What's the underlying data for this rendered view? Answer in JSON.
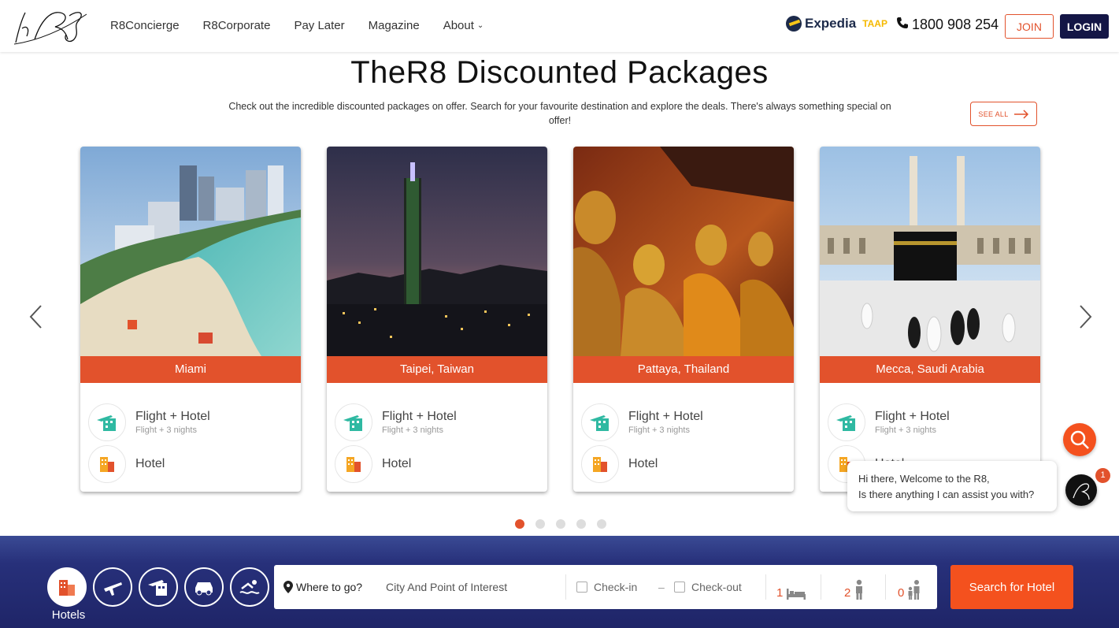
{
  "header": {
    "nav": [
      {
        "label": "R8Concierge"
      },
      {
        "label": "R8Corporate"
      },
      {
        "label": "Pay Later"
      },
      {
        "label": "Magazine"
      },
      {
        "label": "About"
      }
    ],
    "expedia": {
      "brand": "Expedia",
      "taap": "TAAP"
    },
    "phone": "1800 908 254",
    "join_label": "JOIN",
    "login_label": "LOGIN"
  },
  "section": {
    "title": "TheR8 Discounted Packages",
    "subtitle": "Check out the incredible discounted packages on offer. Search for your favourite destination and explore the deals. There's always something special on offer!",
    "see_all_label": "SEE ALL"
  },
  "cards": [
    {
      "destination": "Miami",
      "package_label": "Flight + Hotel",
      "package_sub": "Flight + 3 nights",
      "hotel_label": "Hotel"
    },
    {
      "destination": "Taipei, Taiwan",
      "package_label": "Flight + Hotel",
      "package_sub": "Flight + 3 nights",
      "hotel_label": "Hotel"
    },
    {
      "destination": "Pattaya, Thailand",
      "package_label": "Flight + Hotel",
      "package_sub": "Flight + 3 nights",
      "hotel_label": "Hotel"
    },
    {
      "destination": "Mecca, Saudi Arabia",
      "package_label": "Flight + Hotel",
      "package_sub": "Flight + 3 nights",
      "hotel_label": "Hotel"
    }
  ],
  "carousel": {
    "total_pages": 5,
    "active_page": 1
  },
  "chat": {
    "line1": "Hi there, Welcome to the R8,",
    "line2": "Is there anything I can assist you with?",
    "badge": "1"
  },
  "search": {
    "mode_label": "Hotels",
    "modes": [
      "hotel-icon",
      "flight-icon",
      "flight-hotel-icon",
      "car-icon",
      "activity-icon"
    ],
    "where_label": "Where to go?",
    "where_placeholder": "City And Point of Interest",
    "checkin": "Check-in",
    "dash": "–",
    "checkout": "Check-out",
    "rooms": "1",
    "adults": "2",
    "children": "0",
    "button": "Search for Hotel"
  },
  "colors": {
    "accent": "#e2522c",
    "navy": "#141646"
  }
}
